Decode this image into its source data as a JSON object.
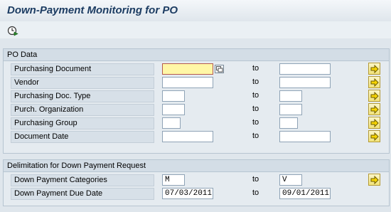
{
  "title": "Down-Payment Monitoring for PO",
  "toolbar": {
    "execute_icon": "execute-clock-icon"
  },
  "po_data": {
    "title": "PO Data",
    "to_label": "to",
    "rows": [
      {
        "label": "Purchasing Document",
        "from": "",
        "to": ""
      },
      {
        "label": "Vendor",
        "from": "",
        "to": ""
      },
      {
        "label": "Purchasing Doc. Type",
        "from": "",
        "to": ""
      },
      {
        "label": "Purch. Organization",
        "from": "",
        "to": ""
      },
      {
        "label": "Purchasing Group",
        "from": "",
        "to": ""
      },
      {
        "label": "Document Date",
        "from": "",
        "to": ""
      }
    ]
  },
  "delimitation": {
    "title": "Delimitation for Down Payment Request",
    "to_label": "to",
    "rows": [
      {
        "label": "Down Payment Categories",
        "from": "M",
        "to": "V"
      },
      {
        "label": "Down Payment Due Date",
        "from": "07/03/2011",
        "to": "09/01/2011"
      }
    ]
  },
  "colors": {
    "accent": "#1c3c62",
    "focus_field": "#fff7a6",
    "multiple_selection_button": "#f2e37a"
  }
}
